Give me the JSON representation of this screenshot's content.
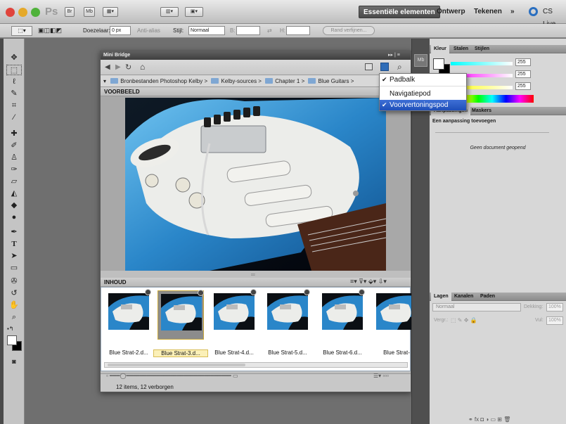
{
  "app": {
    "logo": "Ps",
    "bridge_btn": "Br",
    "minibridge_btn": "Mb"
  },
  "workspace": {
    "active": "Essentiële elementen",
    "others": [
      "Ontwerp",
      "Tekenen"
    ],
    "more": "»",
    "cslive": "CS Live"
  },
  "options": {
    "feather_label": "Doezelaar:",
    "feather_value": "0 px",
    "antialias": "Anti-alias",
    "style_label": "Stijl:",
    "style_value": "Normaal",
    "w_label": "B:",
    "h_label": "H:",
    "refine": "Rand verfijnen..."
  },
  "bridge": {
    "title": "Mini Bridge",
    "breadcrumb": [
      "Bronbestanden Photoshop Kelby",
      "Kelby-sources",
      "Chapter 1",
      "Blue Guitars"
    ],
    "preview_header": "VOORBEELD",
    "content_header": "INHOUD",
    "thumbnails": [
      {
        "label": "Blue Strat-2.d..."
      },
      {
        "label": "Blue Strat-3.d..."
      },
      {
        "label": "Blue Strat-4.d..."
      },
      {
        "label": "Blue Strat-5.d..."
      },
      {
        "label": "Blue Strat-6.d..."
      },
      {
        "label": "Blue Strat-"
      }
    ],
    "status": "12 items, 12 verborgen"
  },
  "dropdown": {
    "items": [
      "Padbalk",
      "Navigatiepod",
      "Voorvertoningspod"
    ]
  },
  "panels": {
    "color_tabs": [
      "Kleur",
      "Stalen",
      "Stijlen"
    ],
    "color_values": [
      "255",
      "255",
      "255"
    ],
    "adjust_tabs": [
      "Aanpassingen",
      "Maskers"
    ],
    "adjust_add": "Een aanpassing toevoegen",
    "adjust_empty": "Geen document geopend",
    "layer_tabs": [
      "Lagen",
      "Kanalen",
      "Paden"
    ],
    "blend_mode": "Normaal",
    "opacity_label": "Dekking:",
    "opacity_value": "100%",
    "lock_label": "Vergr.:",
    "fill_label": "Vul:",
    "fill_value": "100%"
  },
  "colors": {
    "accent": "#1f4fb8",
    "guitar_blue": "#2a86c9"
  }
}
